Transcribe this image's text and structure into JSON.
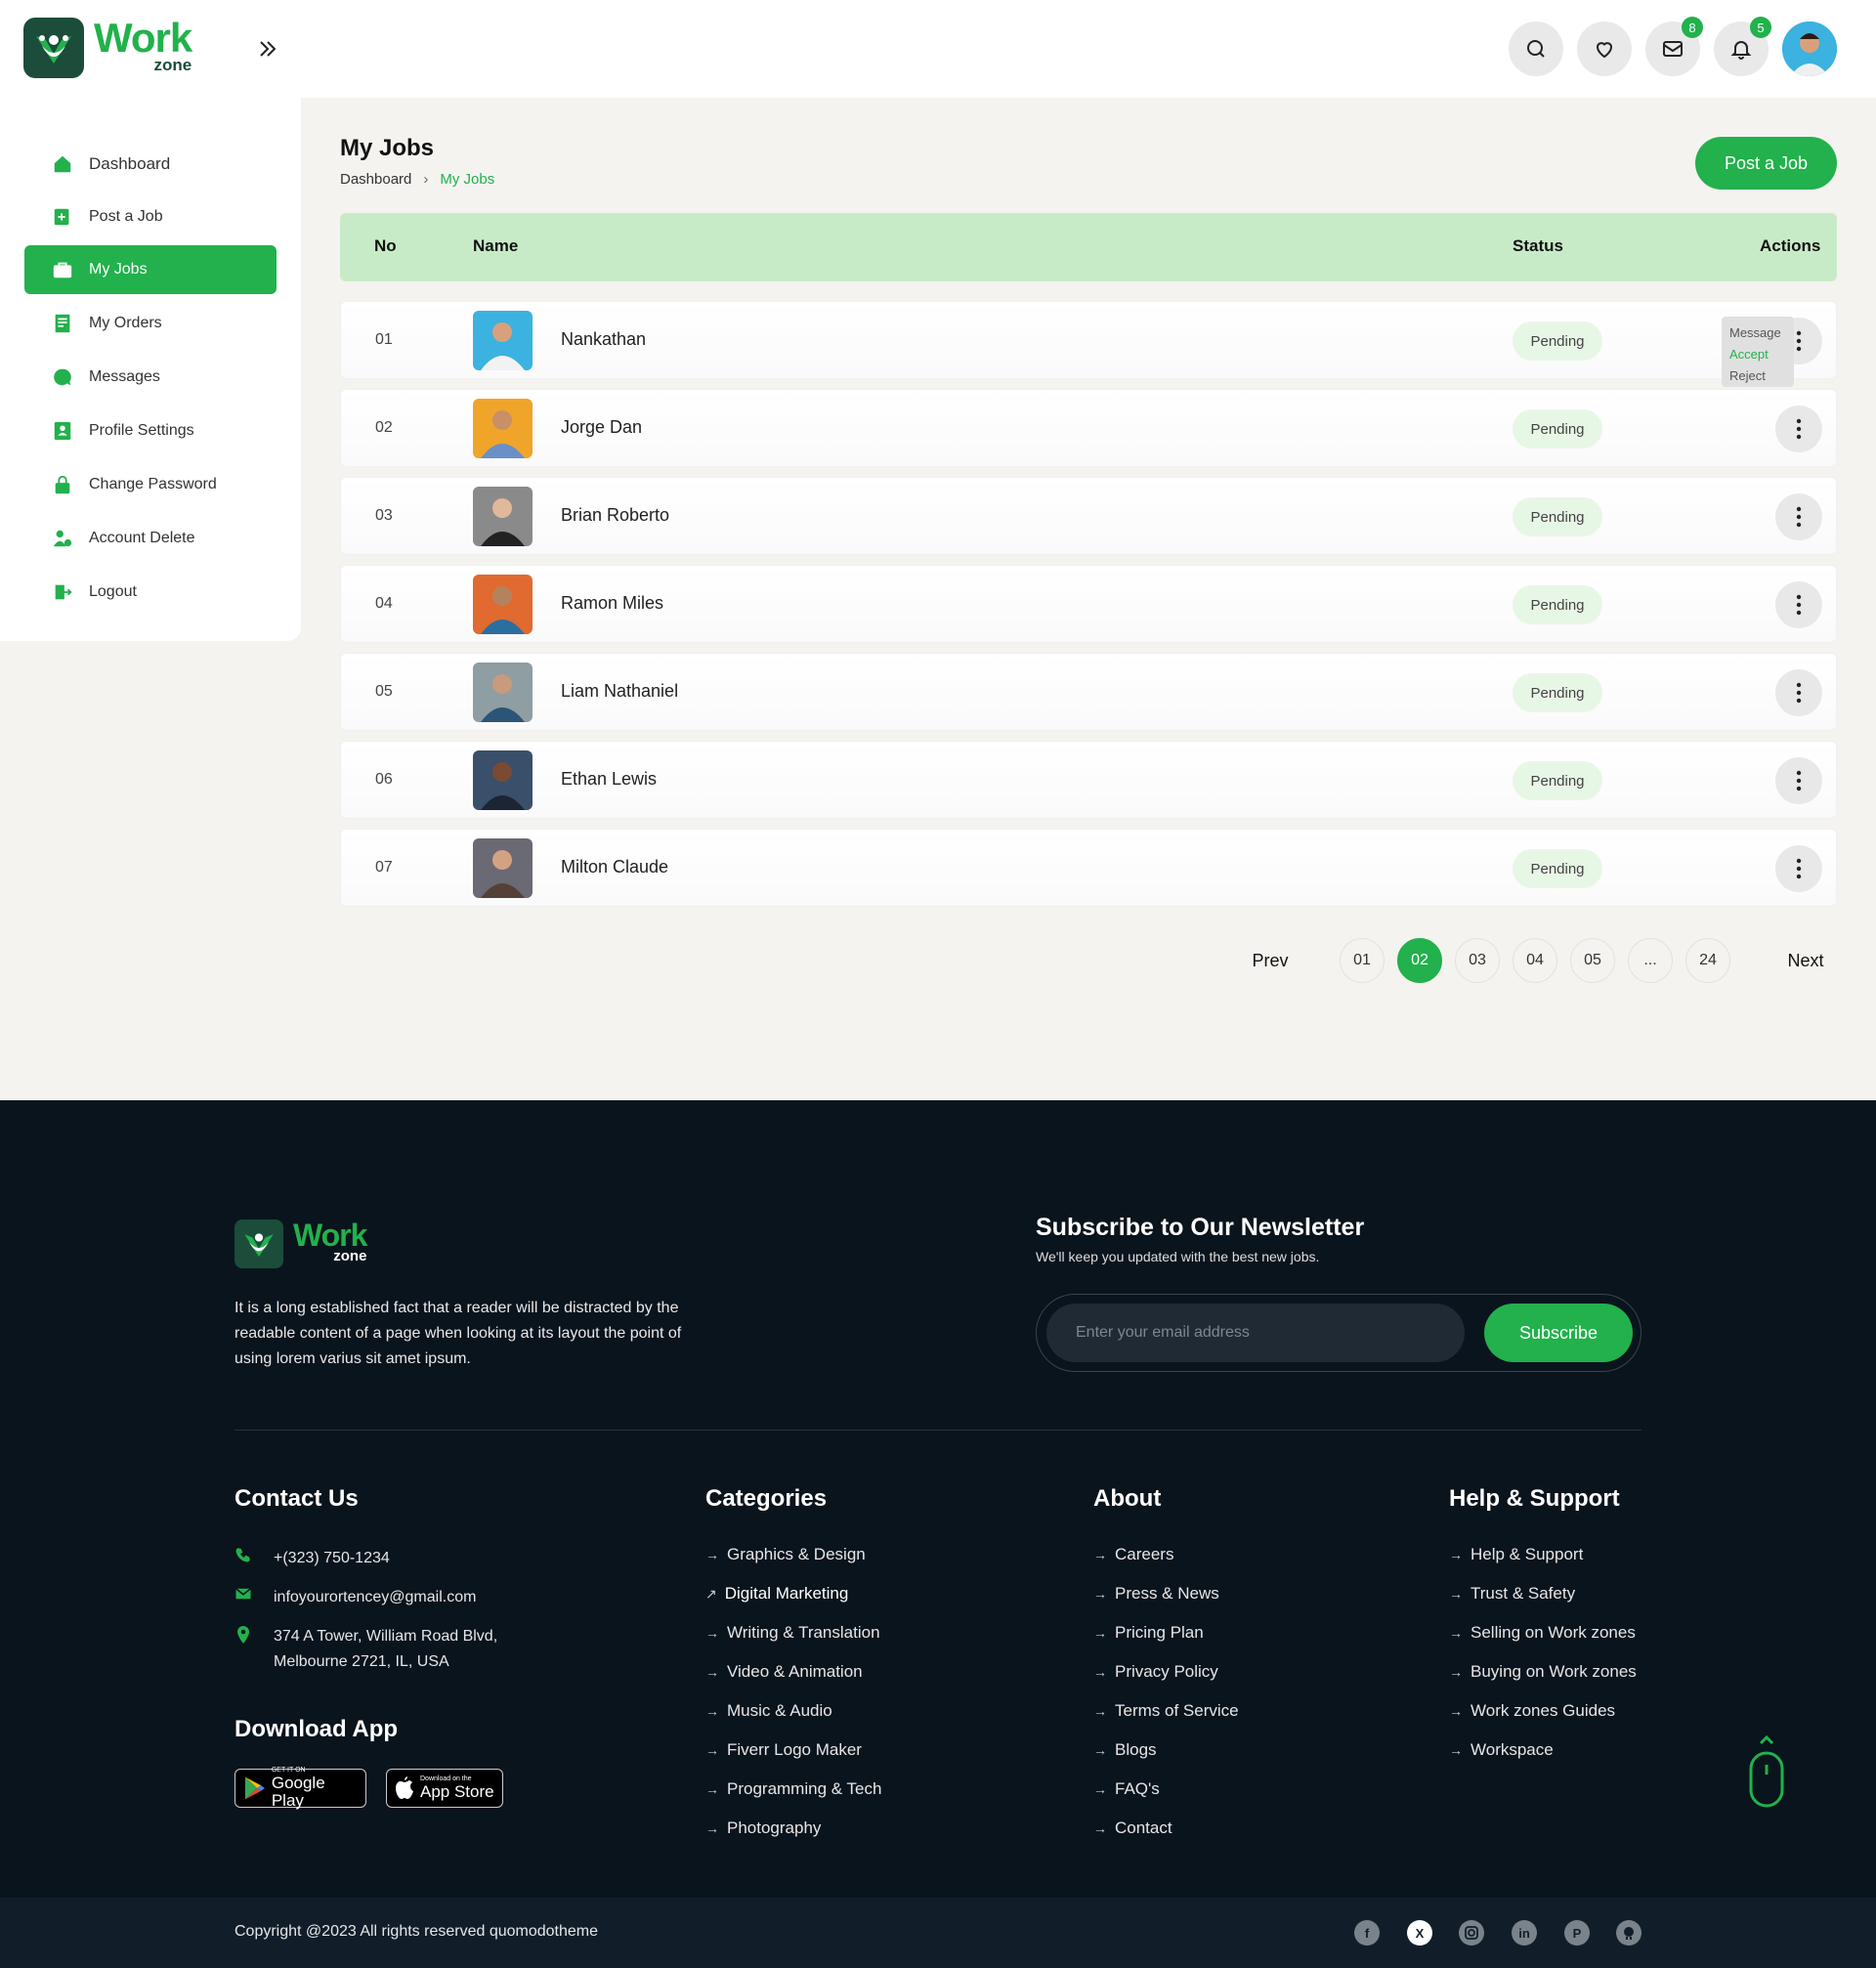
{
  "brand": {
    "name": "Work",
    "sub": "zone",
    "green": "#22b14c",
    "dark": "#1b4d3a"
  },
  "header": {
    "messages_badge": "8",
    "notifications_badge": "5"
  },
  "sidebar": {
    "items": [
      {
        "label": "Dashboard",
        "icon": "home-icon"
      },
      {
        "label": "Post a Job",
        "icon": "post-job-icon"
      },
      {
        "label": "My Jobs",
        "icon": "briefcase-icon",
        "active": true
      },
      {
        "label": "My Orders",
        "icon": "orders-icon"
      },
      {
        "label": "Messages",
        "icon": "chat-icon"
      },
      {
        "label": "Profile Settings",
        "icon": "profile-icon"
      },
      {
        "label": "Change Password",
        "icon": "lock-icon"
      },
      {
        "label": "Account Delete",
        "icon": "user-delete-icon"
      },
      {
        "label": "Logout",
        "icon": "logout-icon"
      }
    ]
  },
  "main": {
    "title": "My Jobs",
    "breadcrumb": {
      "parent": "Dashboard",
      "current": "My Jobs"
    },
    "post_button": "Post a Job",
    "table": {
      "headers": {
        "no": "No",
        "name": "Name",
        "status": "Status",
        "actions": "Actions"
      },
      "rows": [
        {
          "no": "01",
          "name": "Nankathan",
          "status": "Pending"
        },
        {
          "no": "02",
          "name": "Jorge Dan",
          "status": "Pending"
        },
        {
          "no": "03",
          "name": "Brian Roberto",
          "status": "Pending"
        },
        {
          "no": "04",
          "name": "Ramon Miles",
          "status": "Pending"
        },
        {
          "no": "05",
          "name": "Liam Nathaniel",
          "status": "Pending"
        },
        {
          "no": "06",
          "name": "Ethan Lewis",
          "status": "Pending"
        },
        {
          "no": "07",
          "name": "Milton Claude",
          "status": "Pending"
        }
      ]
    },
    "action_menu": {
      "message": "Message",
      "accept": "Accept",
      "reject": "Reject"
    },
    "pagination": {
      "prev": "Prev",
      "next": "Next",
      "pages": [
        "01",
        "02",
        "03",
        "04",
        "05",
        "...",
        "24"
      ],
      "current": "02"
    }
  },
  "footer": {
    "about": "It is a long established fact that a reader will be distracted by the readable content of a page when looking at its layout the point of using lorem varius sit amet ipsum.",
    "newsletter": {
      "title": "Subscribe to Our Newsletter",
      "subtitle": "We'll keep you updated with the best new jobs.",
      "placeholder": "Enter your email address",
      "button": "Subscribe"
    },
    "contact": {
      "title": "Contact Us",
      "phone": "+(323) 750-1234",
      "email": "infoyourortencey@gmail.com",
      "address1": "374 A Tower, William Road Blvd,",
      "address2": "Melbourne 2721, IL, USA"
    },
    "download": {
      "title": "Download App",
      "google_small": "GET IT ON",
      "google_big": "Google Play",
      "apple_small": "Download on the",
      "apple_big": "App Store"
    },
    "categories": {
      "title": "Categories",
      "links": [
        "Graphics & Design",
        "Digital Marketing",
        "Writing & Translation",
        "Video & Animation",
        "Music & Audio",
        "Fiverr Logo Maker",
        "Programming & Tech",
        "Photography"
      ]
    },
    "about_col": {
      "title": "About",
      "links": [
        "Careers",
        "Press & News",
        "Pricing Plan",
        "Privacy Policy",
        "Terms of Service",
        "Blogs",
        "FAQ's",
        "Contact"
      ]
    },
    "help": {
      "title": "Help & Support",
      "links": [
        "Help & Support",
        "Trust & Safety",
        "Selling on Work zones",
        "Buying on Work zones",
        "Work zones Guides",
        "Workspace"
      ]
    },
    "copyright": "Copyright @2023 All rights reserved quomodotheme"
  }
}
